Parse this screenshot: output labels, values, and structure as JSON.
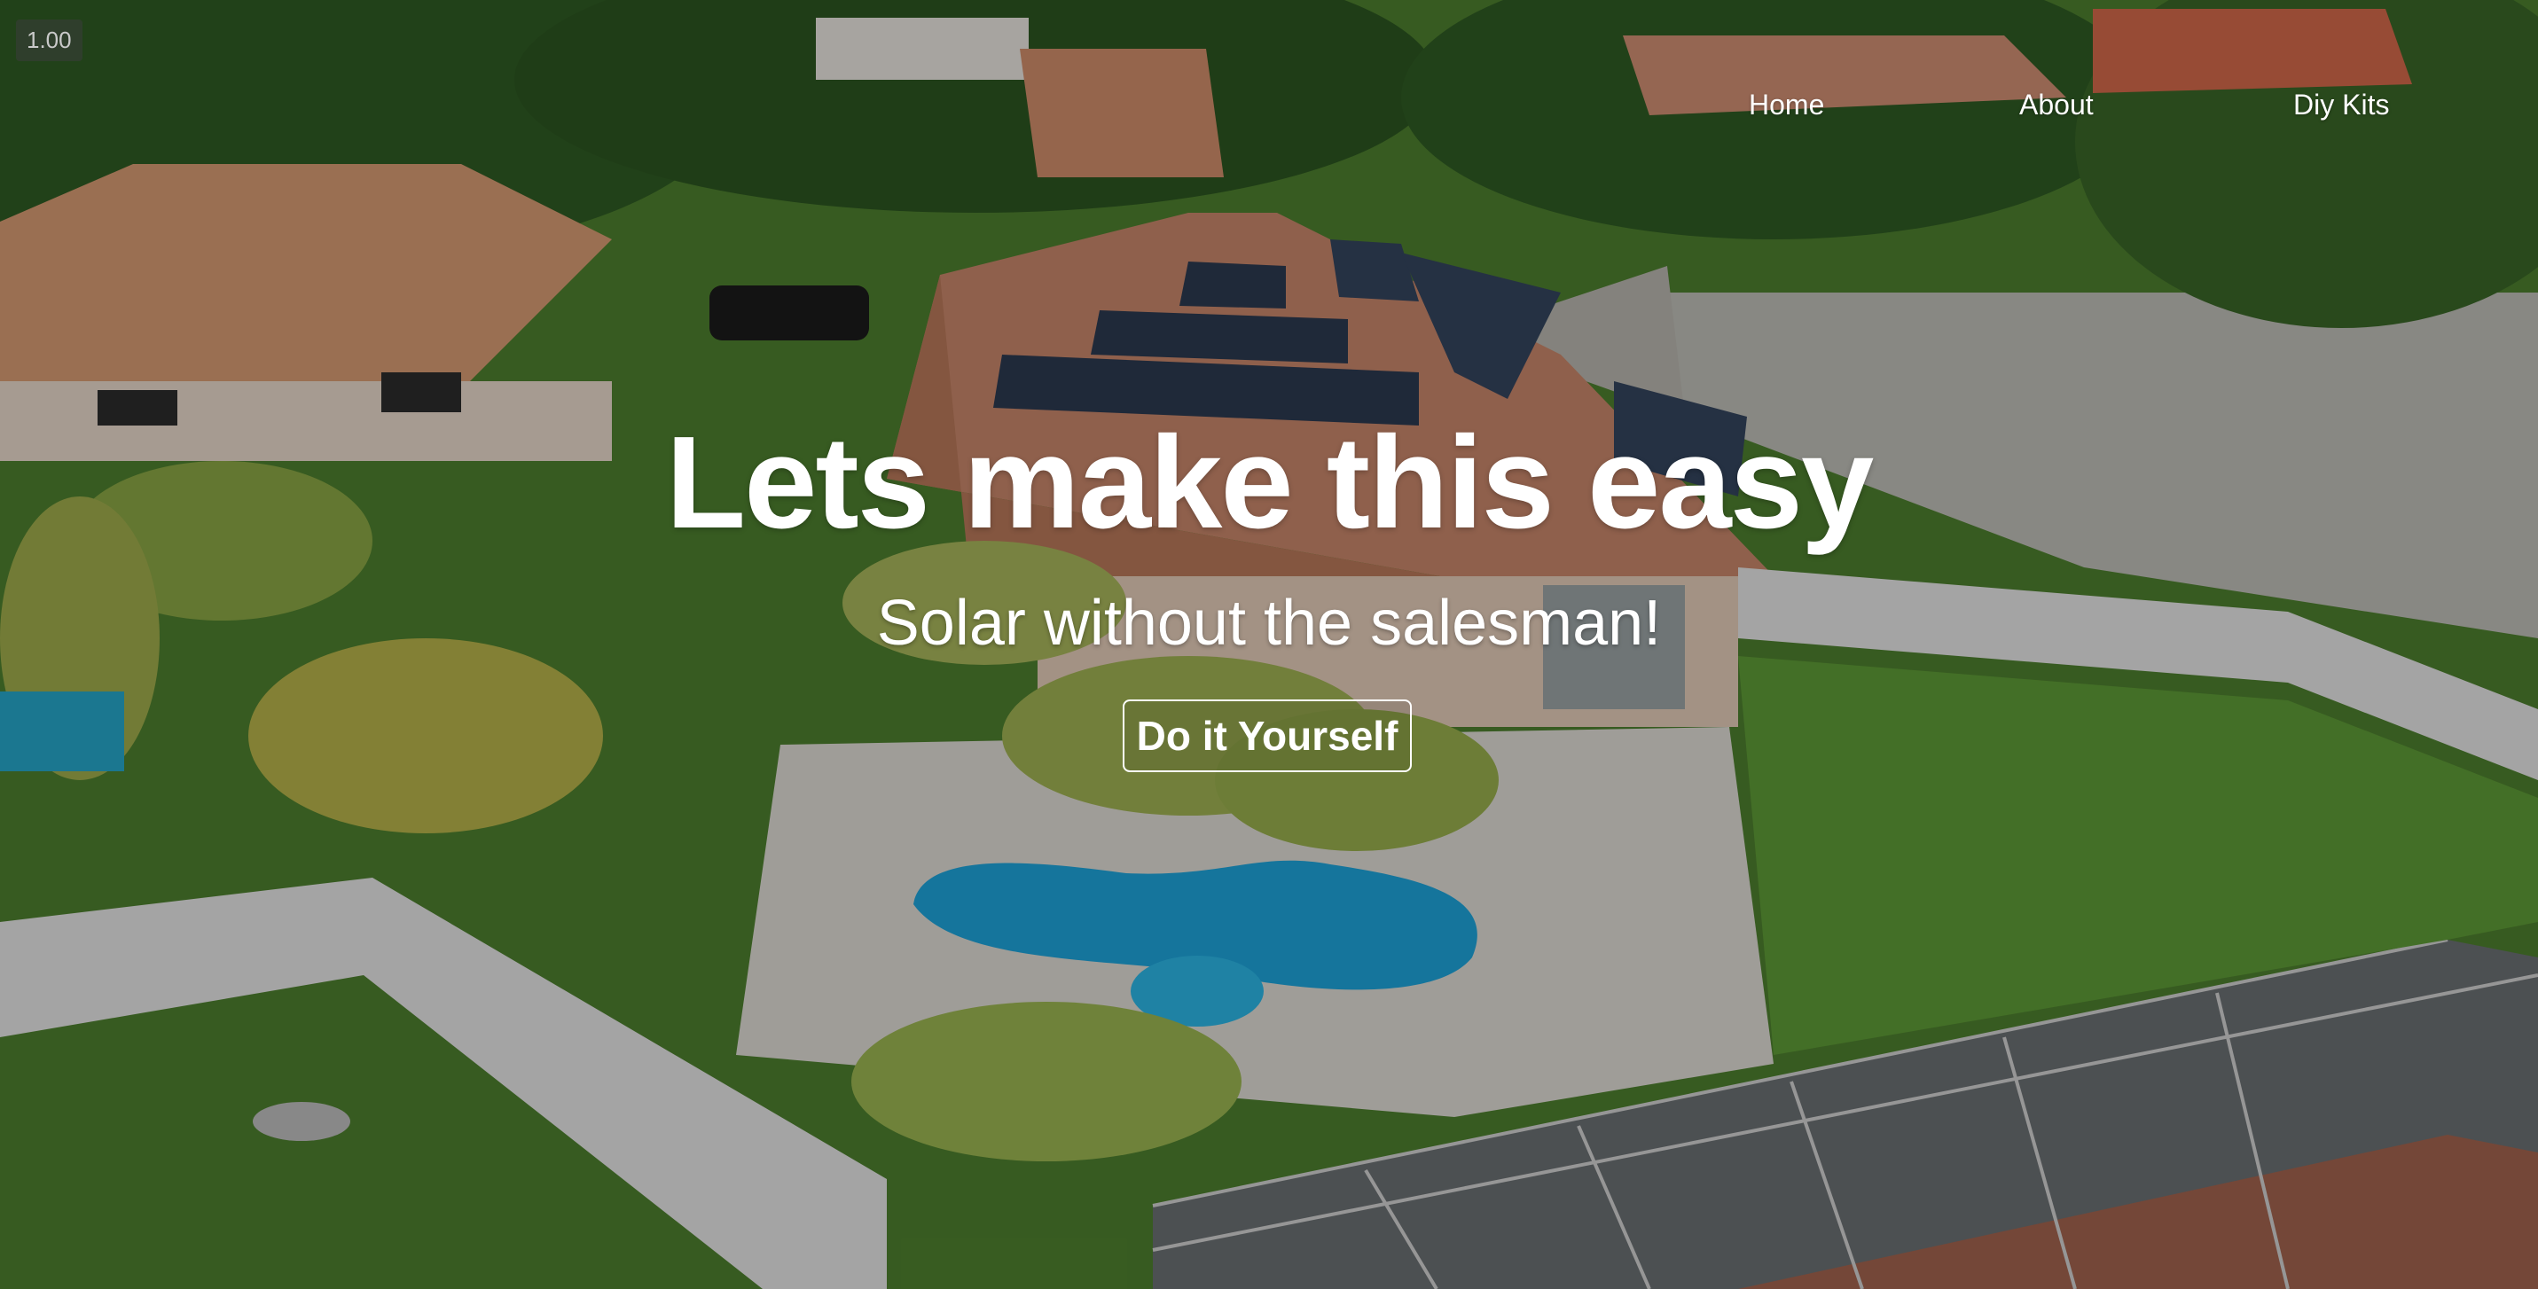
{
  "viewport": {
    "zoom_badge": "1.00"
  },
  "nav": {
    "links": [
      {
        "label": "Home"
      },
      {
        "label": "About"
      },
      {
        "label": "Diy Kits"
      }
    ]
  },
  "hero": {
    "title": "Lets make this easy",
    "subtitle": "Solar without the salesman!",
    "cta_label": "Do it Yourself"
  },
  "colors": {
    "text": "#ffffff",
    "lawn": "#4f8a2d",
    "roof": "#c48864",
    "pool": "#1aa0d6",
    "fence": "#e6e6e6"
  }
}
